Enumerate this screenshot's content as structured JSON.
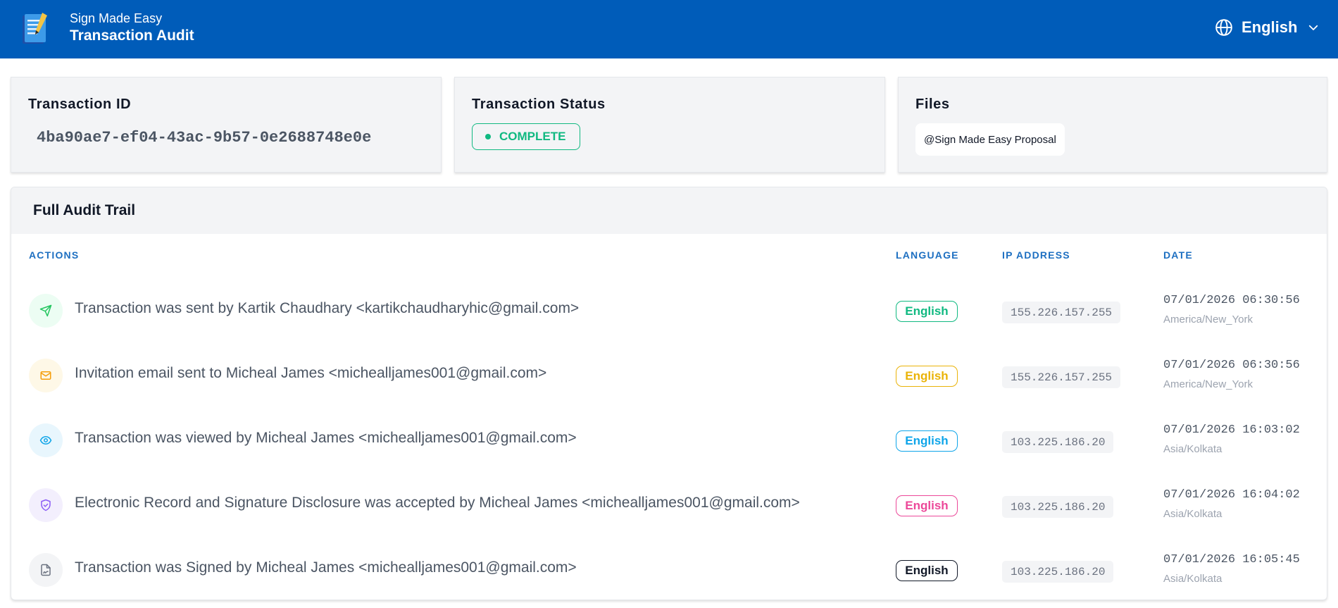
{
  "header": {
    "brand_sub": "Sign Made Easy",
    "brand_title": "Transaction Audit",
    "language": "English",
    "logo_icon": "document-pen-logo",
    "globe_icon": "globe-icon",
    "chevron_icon": "chevron-down-icon",
    "background": "#005cb9"
  },
  "cards": {
    "transaction_id": {
      "title": "Transaction ID",
      "value": "4ba90ae7-ef04-43ac-9b57-0e2688748e0e"
    },
    "transaction_status": {
      "title": "Transaction Status",
      "value": "COMPLETE",
      "color": "#10b981"
    },
    "files": {
      "title": "Files",
      "items": [
        "@Sign Made Easy Proposal"
      ]
    }
  },
  "audit": {
    "title": "Full Audit Trail",
    "columns": {
      "actions": "ACTIONS",
      "language": "LANGUAGE",
      "ip": "IP ADDRESS",
      "date": "DATE"
    },
    "rows": [
      {
        "icon": "send-icon",
        "icon_color": "#22c55e",
        "icon_bg": "#ecfdf3",
        "action": "Transaction was sent by Kartik Chaudhary <kartikchaudharyhic@gmail.com>",
        "language": "English",
        "language_color": "#10b981",
        "ip": "155.226.157.255",
        "date": "07/01/2026 06:30:56",
        "timezone": "America/New_York"
      },
      {
        "icon": "mail-icon",
        "icon_color": "#f59e0b",
        "icon_bg": "#fef8e7",
        "action": "Invitation email sent to Micheal James <michealljames001@gmail.com>",
        "language": "English",
        "language_color": "#eab308",
        "ip": "155.226.157.255",
        "date": "07/01/2026 06:30:56",
        "timezone": "America/New_York"
      },
      {
        "icon": "eye-icon",
        "icon_color": "#0ea5e9",
        "icon_bg": "#e8f6fd",
        "action": "Transaction was viewed by Micheal James <michealljames001@gmail.com>",
        "language": "English",
        "language_color": "#0ea5e9",
        "ip": "103.225.186.20",
        "date": "07/01/2026 16:03:02",
        "timezone": "Asia/Kolkata"
      },
      {
        "icon": "shield-check-icon",
        "icon_color": "#8b5cf6",
        "icon_bg": "#f3effd",
        "action": "Electronic Record and Signature Disclosure was accepted by Micheal James <michealljames001@gmail.com>",
        "language": "English",
        "language_color": "#ec4899",
        "ip": "103.225.186.20",
        "date": "07/01/2026 16:04:02",
        "timezone": "Asia/Kolkata"
      },
      {
        "icon": "signed-document-icon",
        "icon_color": "#6b7280",
        "icon_bg": "#f3f4f6",
        "action": "Transaction was Signed by Micheal James <michealljames001@gmail.com>",
        "language": "English",
        "language_color": "#111827",
        "ip": "103.225.186.20",
        "date": "07/01/2026 16:05:45",
        "timezone": "Asia/Kolkata"
      }
    ]
  }
}
